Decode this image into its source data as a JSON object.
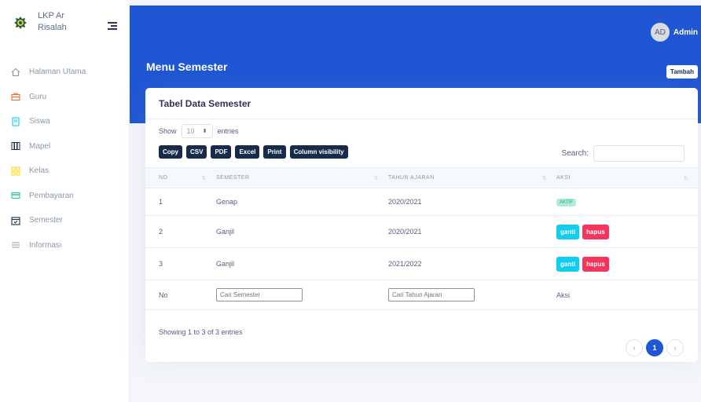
{
  "brand": {
    "name": "LKP Ar Risalah"
  },
  "sidebar": {
    "items": [
      {
        "label": "Halaman Utama",
        "icon": "home-icon",
        "color": "#8898aa"
      },
      {
        "label": "Guru",
        "icon": "briefcase-icon",
        "color": "#fb6340"
      },
      {
        "label": "Siswa",
        "icon": "notebook-icon",
        "color": "#11cdef"
      },
      {
        "label": "Mapel",
        "icon": "books-icon",
        "color": "#172b4d"
      },
      {
        "label": "Kelas",
        "icon": "grid-icon",
        "color": "#ffd600"
      },
      {
        "label": "Pembayaran",
        "icon": "credit-card-icon",
        "color": "#2dce89"
      },
      {
        "label": "Semester",
        "icon": "calendar-icon",
        "color": "#172b4d"
      },
      {
        "label": "Informasi",
        "icon": "list-icon",
        "color": "#8898aa"
      }
    ]
  },
  "header": {
    "avatar_initials": "AD",
    "username": "Admin",
    "page_title": "Menu Semester",
    "add_button": "Tambah"
  },
  "card": {
    "title": "Tabel Data Semester",
    "length": {
      "show": "Show",
      "value": "10",
      "entries": "entries"
    },
    "buttons": [
      "Copy",
      "CSV",
      "PDF",
      "Excel",
      "Print",
      "Column visibility"
    ],
    "search_label": "Search:",
    "columns": [
      "NO",
      "SEMESTER",
      "TAHUN AJARAN",
      "AKSI"
    ],
    "rows": [
      {
        "no": "1",
        "semester": "Genap",
        "tahun": "2020/2021",
        "status": "AKTIF"
      },
      {
        "no": "2",
        "semester": "Ganjil",
        "tahun": "2020/2021",
        "edit": "ganti",
        "delete": "hapus"
      },
      {
        "no": "3",
        "semester": "Ganjil",
        "tahun": "2021/2022",
        "edit": "ganti",
        "delete": "hapus"
      }
    ],
    "footer": {
      "no": "No",
      "semester_placeholder": "Cari Semester",
      "tahun_placeholder": "Cari Tahun Ajaran",
      "aksi": "Aksi"
    },
    "info": "Showing 1 to 3 of 3 entries",
    "pagination": {
      "prev": "‹",
      "current": "1",
      "next": "›"
    }
  },
  "colors": {
    "primary": "#1e56d4",
    "dark": "#172b4d",
    "info": "#11cdef",
    "danger": "#f5365c",
    "success_bg": "#b0eed3"
  }
}
